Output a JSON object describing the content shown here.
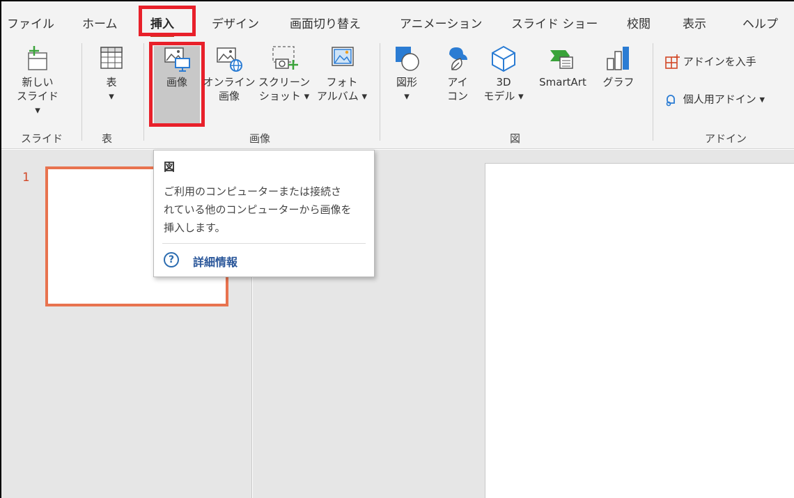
{
  "tabs": [
    "ファイル",
    "ホーム",
    "挿入",
    "デザイン",
    "画面切り替え",
    "アニメーション",
    "スライド ショー",
    "校閲",
    "表示",
    "ヘルプ"
  ],
  "active_tab": "挿入",
  "ribbon": {
    "new_slide": {
      "line1": "新しい",
      "line2": "スライド ▾"
    },
    "table": {
      "line1": "表",
      "line2": "▾"
    },
    "image": {
      "line1": "画像"
    },
    "online_image": {
      "line1": "オンライン",
      "line2": "画像"
    },
    "screenshot": {
      "line1": "スクリーン",
      "line2": "ショット ▾"
    },
    "photo_album": {
      "line1": "フォト",
      "line2": "アルバム ▾"
    },
    "shapes": {
      "line1": "図形",
      "line2": "▾"
    },
    "icons": {
      "line1": "アイ",
      "line2": "コン"
    },
    "model3d": {
      "line1": "3D",
      "line2": "モデル ▾"
    },
    "smartart": {
      "line1": "SmartArt"
    },
    "chart": {
      "line1": "グラフ"
    },
    "get_addins": "アドインを入手",
    "my_addins": "個人用アドイン ▾",
    "groups": {
      "slides": "スライド",
      "tables": "表",
      "images": "画像",
      "illustrations": "図",
      "addins": "アドイン"
    }
  },
  "thumbnail": {
    "number": "1"
  },
  "tooltip": {
    "title": "図",
    "line1": "ご利用のコンピューターまたは接続さ",
    "line2": "れている他のコンピューターから画像を",
    "line3": "挿入します。",
    "help_icon": "?",
    "link": "詳細情報"
  },
  "colors": {
    "accent": "#c43e1c",
    "highlight_box": "#e8202a",
    "thumbnail_border": "#e8734f",
    "link": "#2b579a"
  }
}
